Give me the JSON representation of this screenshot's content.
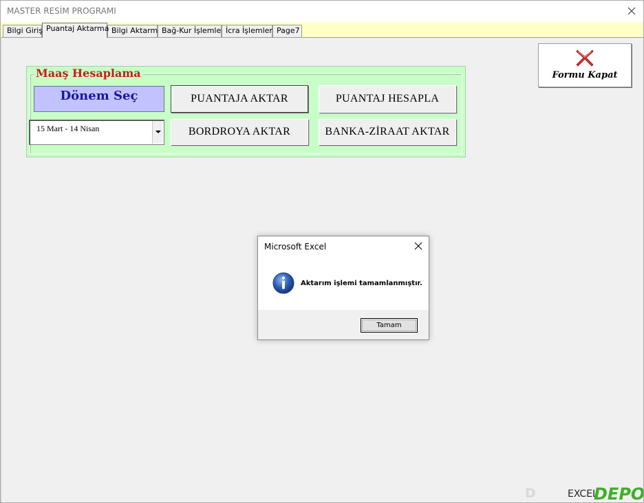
{
  "window": {
    "title": "MASTER RESİM PROGRAMI"
  },
  "tabs": [
    {
      "label": "Bilgi Girişi",
      "active": false
    },
    {
      "label": "Puantaj Aktarma",
      "active": true
    },
    {
      "label": "Bilgi Aktarma",
      "active": false
    },
    {
      "label": "Bağ-Kur İşlemleri",
      "active": false
    },
    {
      "label": "İcra İşlemleri",
      "active": false
    },
    {
      "label": "Page7",
      "active": false
    }
  ],
  "group": {
    "title": "Maaş Hesaplama",
    "donem_label": "Dönem Seç",
    "period_select": {
      "value": "15 Mart - 14 Nisan"
    },
    "buttons": {
      "puantaja_aktar": "PUANTAJA AKTAR",
      "puantaj_hesapla": "PUANTAJ HESAPLA",
      "bordroya_aktar": "BORDROYA AKTAR",
      "banka_ziraat_aktar": "BANKA-ZİRAAT AKTAR"
    }
  },
  "close_form": {
    "label": "Formu Kapat",
    "icon": "red-x-icon"
  },
  "message_box": {
    "title": "Microsoft Excel",
    "icon": "info-icon",
    "message": "Aktarım işlemi tamamlanmıştır.",
    "ok_label": "Tamam"
  },
  "watermark": {
    "text_left": "D",
    "text_mid": "EXCEL",
    "text_right": "DEPO"
  },
  "colors": {
    "tabstrip_bg": "#ffffc8",
    "group_bg": "#c8ffc8",
    "group_title": "#c0201a",
    "donem_bg": "#c2c2ff",
    "donem_text": "#1717a3",
    "close_icon": "#d9302c",
    "info_icon": "#2a5bb0",
    "watermark_green": "#3fae2a"
  }
}
